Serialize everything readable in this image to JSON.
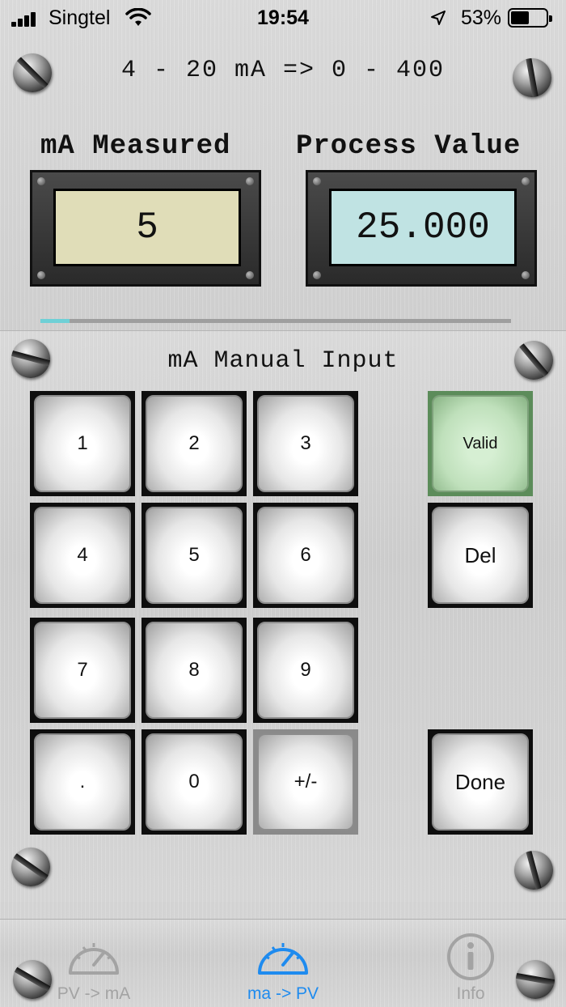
{
  "status_bar": {
    "carrier": "Singtel",
    "time": "19:54",
    "battery_percent": "53%",
    "battery_level": 0.53,
    "icons": [
      "signal-icon",
      "wifi-icon",
      "location-icon",
      "battery-icon"
    ]
  },
  "conversion": {
    "range_title": "4 - 20 mA => 0 - 400"
  },
  "displays": {
    "ma_label": "mA Measured",
    "ma_value": "5",
    "pv_label": "Process Value",
    "pv_value": "25.000"
  },
  "progress": {
    "fraction": 0.0625
  },
  "keypad": {
    "title": "mA Manual Input",
    "keys": {
      "k1": "1",
      "k2": "2",
      "k3": "3",
      "k4": "4",
      "k5": "5",
      "k6": "6",
      "k7": "7",
      "k8": "8",
      "k9": "9",
      "dot": ".",
      "k0": "0",
      "sign": "+/-"
    },
    "valid": "Valid",
    "del": "Del",
    "done": "Done"
  },
  "tab_bar": {
    "tabs": [
      {
        "label": "PV -> mA",
        "icon": "gauge-icon",
        "active": false
      },
      {
        "label": "ma -> PV",
        "icon": "gauge-icon",
        "active": true
      },
      {
        "label": "Info",
        "icon": "info-icon",
        "active": false
      }
    ]
  },
  "colors": {
    "ma_display_bg": "#e0ddb8",
    "pv_display_bg": "#c0e3e3",
    "progress_fill": "#6fd0d6",
    "active_tab": "#1e8bef",
    "inactive_tab": "#a3a3a3",
    "valid_key": "#bfe0bb"
  }
}
